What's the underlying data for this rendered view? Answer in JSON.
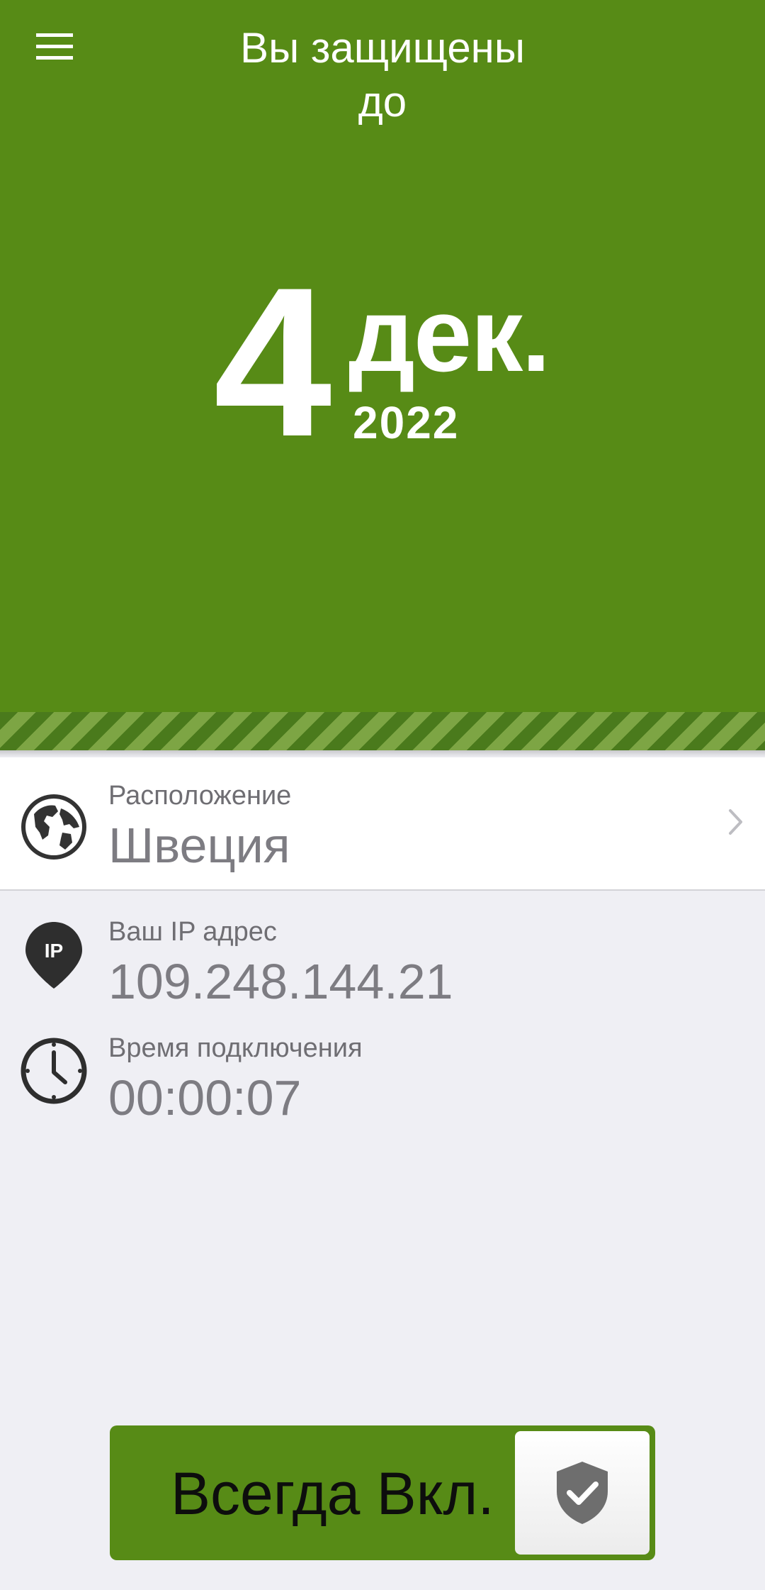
{
  "theme": {
    "accent": "#578b16",
    "text_muted": "#7d7c82"
  },
  "header": {
    "menu_icon": "hamburger-menu-icon",
    "title_line1": "Вы защищены",
    "title_line2": "до"
  },
  "expiry": {
    "day": "4",
    "month": "дек.",
    "year": "2022"
  },
  "location": {
    "icon": "globe-icon",
    "label": "Расположение",
    "value": "Швеция",
    "chevron": "chevron-right-icon"
  },
  "ip": {
    "icon": "ip-pin-icon",
    "badge": "IP",
    "label": "Ваш IP адрес",
    "value": "109.248.144.21"
  },
  "connection_time": {
    "icon": "clock-icon",
    "label": "Время подключения",
    "value": "00:00:07"
  },
  "toggle": {
    "label": "Всегда Вкл.",
    "icon": "shield-check-icon",
    "state": "on"
  }
}
